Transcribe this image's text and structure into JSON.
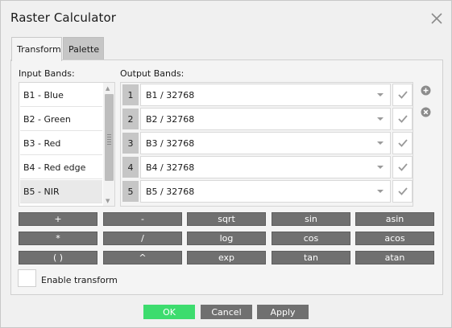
{
  "window": {
    "title": "Raster Calculator",
    "close_icon": "close-icon"
  },
  "tabs": [
    {
      "label": "Transform",
      "active": true
    },
    {
      "label": "Palette",
      "active": false
    }
  ],
  "input_bands": {
    "label": "Input Bands:",
    "items": [
      "B1 - Blue",
      "B2 - Green",
      "B3 - Red",
      "B4 - Red edge",
      "B5 - NIR"
    ],
    "selected": "B5 - NIR"
  },
  "output_bands": {
    "label": "Output Bands:",
    "rows": [
      {
        "num": "1",
        "expr": "B1 / 32768"
      },
      {
        "num": "2",
        "expr": "B2 / 32768"
      },
      {
        "num": "3",
        "expr": "B3 / 32768"
      },
      {
        "num": "4",
        "expr": "B4 / 32768"
      },
      {
        "num": "5",
        "expr": "B5 / 32768"
      }
    ],
    "add_icon": "plus-circle-icon",
    "remove_icon": "x-circle-icon"
  },
  "operators": [
    [
      "+",
      "-",
      "sqrt",
      "sin",
      "asin"
    ],
    [
      "*",
      "/",
      "log",
      "cos",
      "acos"
    ],
    [
      "( )",
      "^",
      "exp",
      "tan",
      "atan"
    ]
  ],
  "enable_transform": {
    "label": "Enable transform",
    "checked": false
  },
  "footer": {
    "ok": "OK",
    "cancel": "Cancel",
    "apply": "Apply"
  },
  "colors": {
    "ok_green": "#3ddc6e",
    "button_gray": "#707070",
    "tab_inactive": "#c6c6c6"
  }
}
